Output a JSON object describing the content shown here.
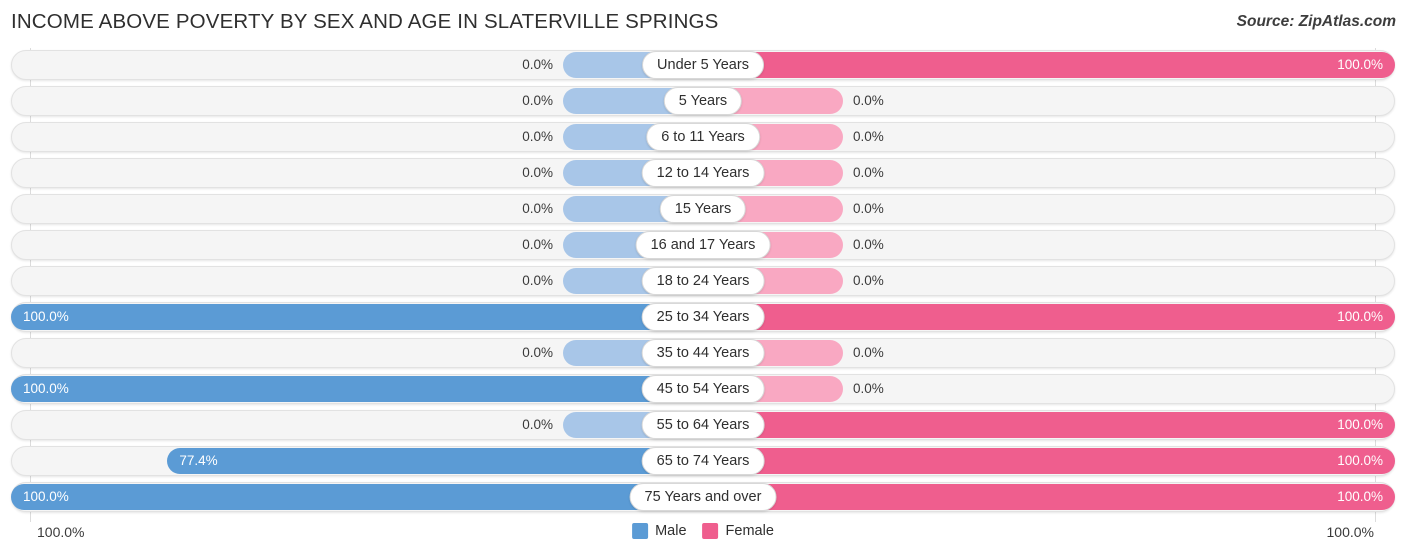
{
  "header": {
    "title": "INCOME ABOVE POVERTY BY SEX AND AGE IN SLATERVILLE SPRINGS",
    "source": "Source: ZipAtlas.com"
  },
  "legend": {
    "male_label": "Male",
    "female_label": "Female",
    "male_color": "#5b9bd5",
    "female_color": "#ef5e8e",
    "male_zero_color": "#a8c6e8",
    "female_zero_color": "#f9a8c2"
  },
  "axis": {
    "left_label": "100.0%",
    "right_label": "100.0%"
  },
  "chart_data": {
    "type": "bar",
    "title": "INCOME ABOVE POVERTY BY SEX AND AGE IN SLATERVILLE SPRINGS",
    "subtitle": "",
    "xlabel": "",
    "ylabel": "",
    "orientation": "horizontal-diverging",
    "grid": true,
    "legend_position": "bottom-center",
    "xlim": [
      0,
      100
    ],
    "categories": [
      "Under 5 Years",
      "5 Years",
      "6 to 11 Years",
      "12 to 14 Years",
      "15 Years",
      "16 and 17 Years",
      "18 to 24 Years",
      "25 to 34 Years",
      "35 to 44 Years",
      "45 to 54 Years",
      "55 to 64 Years",
      "65 to 74 Years",
      "75 Years and over"
    ],
    "series": [
      {
        "name": "Male",
        "values": [
          0.0,
          0.0,
          0.0,
          0.0,
          0.0,
          0.0,
          0.0,
          100.0,
          0.0,
          100.0,
          0.0,
          77.4,
          100.0
        ],
        "labels": [
          "0.0%",
          "0.0%",
          "0.0%",
          "0.0%",
          "0.0%",
          "0.0%",
          "0.0%",
          "100.0%",
          "0.0%",
          "100.0%",
          "0.0%",
          "77.4%",
          "100.0%"
        ]
      },
      {
        "name": "Female",
        "values": [
          100.0,
          0.0,
          0.0,
          0.0,
          0.0,
          0.0,
          0.0,
          100.0,
          0.0,
          0.0,
          100.0,
          100.0,
          100.0
        ],
        "labels": [
          "100.0%",
          "0.0%",
          "0.0%",
          "0.0%",
          "0.0%",
          "0.0%",
          "0.0%",
          "100.0%",
          "0.0%",
          "0.0%",
          "100.0%",
          "100.0%",
          "100.0%"
        ]
      }
    ]
  }
}
